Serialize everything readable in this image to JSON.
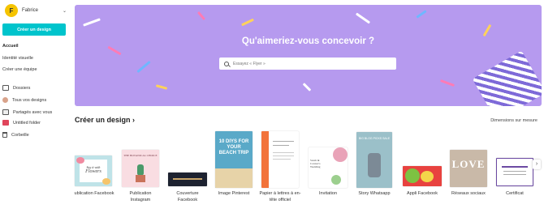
{
  "user": {
    "initial": "F",
    "name": "Fabrice"
  },
  "sidebar": {
    "create_button": "Créer un design",
    "items": [
      {
        "label": "Accueil",
        "icon": ""
      },
      {
        "label": "Identité visuelle",
        "icon": ""
      },
      {
        "label": "Créer une équipe",
        "icon": ""
      },
      {
        "label": "Dossiers",
        "icon": "folder-icon"
      },
      {
        "label": "Tous vos designs",
        "icon": "person-icon"
      },
      {
        "label": "Partagés avec vous",
        "icon": "shared-icon"
      },
      {
        "label": "Untitled folder",
        "icon": "folder-colored-icon"
      },
      {
        "label": "Corbeille",
        "icon": "trash-icon"
      }
    ]
  },
  "hero": {
    "title": "Qu'aimeriez-vous concevoir ?",
    "search_placeholder": "Essayez « Flyer »",
    "background": "#b69aef"
  },
  "section": {
    "title": "Créer un design",
    "link": "Dimensions sur mesure"
  },
  "designs": [
    {
      "label": "ublication Facebook",
      "thumb_text_1": "Say it with",
      "thumb_text_2": "Flowers"
    },
    {
      "label": "Publication\nInstagram",
      "thumb_text_1": "THE BOTANICAL CHOICE",
      "thumb_text_2": ""
    },
    {
      "label": "Couverture\nFacebook",
      "thumb_text_1": "",
      "thumb_text_2": ""
    },
    {
      "label": "Image Pinterest",
      "thumb_text_1": "10 DIYS FOR YOUR BEACH TRIP",
      "thumb_text_2": ""
    },
    {
      "label": "Papier à lettres à en-\ntête officiel",
      "thumb_text_1": "",
      "thumb_text_2": ""
    },
    {
      "label": "Invitation",
      "thumb_text_1": "Sarah & Connor's Wedding",
      "thumb_text_2": ""
    },
    {
      "label": "Story Whatsapp",
      "thumb_text_1": "BIG BLOG PICKS SALE",
      "thumb_text_2": ""
    },
    {
      "label": "Appli Facebook",
      "thumb_text_1": "",
      "thumb_text_2": ""
    },
    {
      "label": "Réseaux sociaux",
      "thumb_text_1": "LOVE",
      "thumb_text_2": ""
    },
    {
      "label": "Certificat",
      "thumb_text_1": "",
      "thumb_text_2": ""
    }
  ]
}
